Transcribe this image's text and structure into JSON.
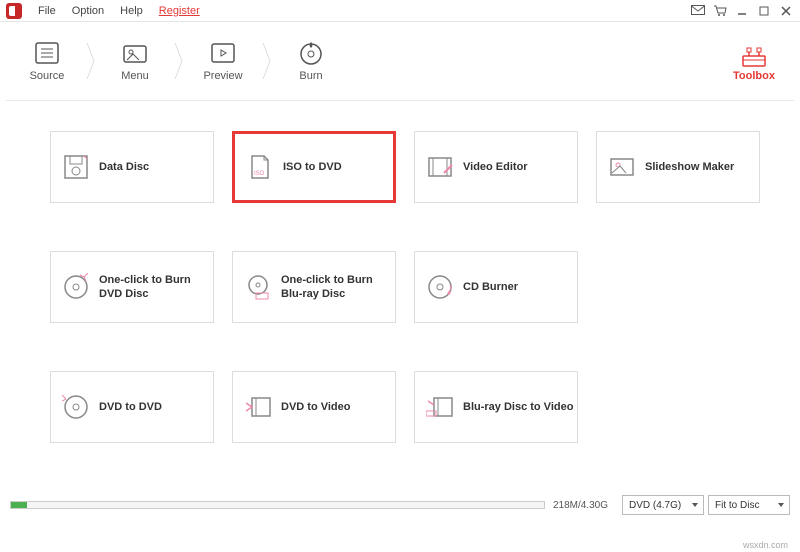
{
  "menubar": {
    "file": "File",
    "option": "Option",
    "help": "Help",
    "register": "Register"
  },
  "steps": {
    "source": "Source",
    "menu": "Menu",
    "preview": "Preview",
    "burn": "Burn"
  },
  "toolbox": "Toolbox",
  "cards": {
    "data_disc": "Data Disc",
    "iso_to_dvd": "ISO to DVD",
    "video_editor": "Video Editor",
    "slideshow_maker": "Slideshow Maker",
    "one_click_dvd": "One-click to Burn DVD Disc",
    "one_click_bluray": "One-click to Burn Blu-ray Disc",
    "cd_burner": "CD Burner",
    "dvd_to_dvd": "DVD to DVD",
    "dvd_to_video": "DVD to Video",
    "bluray_to_video": "Blu-ray Disc to Video"
  },
  "status": {
    "progress_text": "218M/4.30G",
    "dvd_option": "DVD (4.7G)",
    "fit_option": "Fit to Disc"
  },
  "watermark": "wsxdn.com"
}
